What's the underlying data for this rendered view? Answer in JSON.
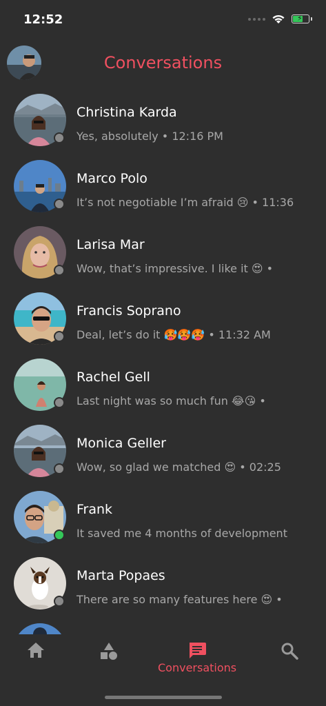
{
  "status_bar": {
    "time": "12:52"
  },
  "header": {
    "title": "Conversations"
  },
  "conversations": [
    {
      "name": "Christina Karda",
      "message": "Yes, absolutely • 12:16 PM",
      "online": false
    },
    {
      "name": "Marco Polo",
      "message": "It’s not negotiable I’m afraid 😢 • 11:36",
      "online": false
    },
    {
      "name": "Larisa Mar",
      "message": "Wow, that’s impressive. I like it 😍 •",
      "online": false
    },
    {
      "name": "Francis Soprano",
      "message": "Deal, let’s do it 🥵🥵🥵 • 11:32 AM",
      "online": false
    },
    {
      "name": "Rachel Gell",
      "message": "Last night was so much fun 😂😘 •",
      "online": false
    },
    {
      "name": "Monica Geller",
      "message": "Wow, so glad we matched 😍 • 02:25",
      "online": false
    },
    {
      "name": "Frank",
      "message": "It saved me 4 months of development",
      "online": true
    },
    {
      "name": "Marta Popaes",
      "message": "There are so many features here 😍 •",
      "online": false
    }
  ],
  "tabbar": {
    "tabs": [
      {
        "icon": "home-icon",
        "label": ""
      },
      {
        "icon": "shapes-icon",
        "label": ""
      },
      {
        "icon": "chat-icon",
        "label": "Conversations",
        "active": true
      },
      {
        "icon": "search-icon",
        "label": ""
      }
    ]
  },
  "colors": {
    "accent": "#f05060",
    "background": "#2e2e2e",
    "online": "#34c759",
    "offline": "#8a8a8a"
  }
}
